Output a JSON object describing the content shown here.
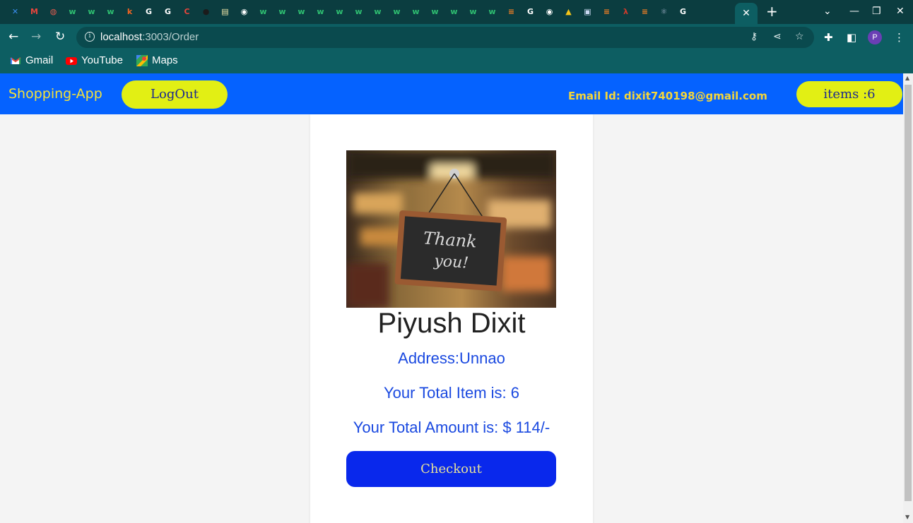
{
  "browser": {
    "tabs": [
      {
        "icon": "confluence-icon",
        "glyph": "✕",
        "color": "#3b8ef0"
      },
      {
        "icon": "gmail-icon",
        "glyph": "M",
        "color": "#e8453c"
      },
      {
        "icon": "globe-icon",
        "glyph": "◍",
        "color": "#e05a4e"
      },
      {
        "icon": "w-icon",
        "glyph": "w",
        "color": "#2fbf71"
      },
      {
        "icon": "w-icon",
        "glyph": "w",
        "color": "#2fbf71"
      },
      {
        "icon": "w-icon",
        "glyph": "w",
        "color": "#2fbf71"
      },
      {
        "icon": "k-icon",
        "glyph": "k",
        "color": "#f26522"
      },
      {
        "icon": "google-icon",
        "glyph": "G",
        "color": "#ffffff"
      },
      {
        "icon": "google-icon",
        "glyph": "G",
        "color": "#ffffff"
      },
      {
        "icon": "c-icon",
        "glyph": "C",
        "color": "#e8453c"
      },
      {
        "icon": "github-icon",
        "glyph": "●",
        "color": "#1b1b1b"
      },
      {
        "icon": "doc-icon",
        "glyph": "▤",
        "color": "#f3e7a8"
      },
      {
        "icon": "chrome-icon",
        "glyph": "◉",
        "color": "#ffffff"
      },
      {
        "icon": "w-icon",
        "glyph": "w",
        "color": "#2fbf71"
      },
      {
        "icon": "w-icon",
        "glyph": "w",
        "color": "#2fbf71"
      },
      {
        "icon": "w-icon",
        "glyph": "w",
        "color": "#2fbf71"
      },
      {
        "icon": "w-icon",
        "glyph": "w",
        "color": "#2fbf71"
      },
      {
        "icon": "w-icon",
        "glyph": "w",
        "color": "#2fbf71"
      },
      {
        "icon": "w-icon",
        "glyph": "w",
        "color": "#2fbf71"
      },
      {
        "icon": "w-icon",
        "glyph": "w",
        "color": "#2fbf71"
      },
      {
        "icon": "w-icon",
        "glyph": "w",
        "color": "#2fbf71"
      },
      {
        "icon": "w-icon",
        "glyph": "w",
        "color": "#2fbf71"
      },
      {
        "icon": "w-icon",
        "glyph": "w",
        "color": "#2fbf71"
      },
      {
        "icon": "w-icon",
        "glyph": "w",
        "color": "#2fbf71"
      },
      {
        "icon": "w-icon",
        "glyph": "w",
        "color": "#2fbf71"
      },
      {
        "icon": "w-icon",
        "glyph": "w",
        "color": "#2fbf71"
      },
      {
        "icon": "stackoverflow-icon",
        "glyph": "≡",
        "color": "#f48024"
      },
      {
        "icon": "google-icon",
        "glyph": "G",
        "color": "#ffffff"
      },
      {
        "icon": "chrome-icon",
        "glyph": "◉",
        "color": "#ffffff"
      },
      {
        "icon": "triangle-icon",
        "glyph": "▲",
        "color": "#f5c518"
      },
      {
        "icon": "app-icon",
        "glyph": "▣",
        "color": "#c9d8f0"
      },
      {
        "icon": "stackoverflow-icon",
        "glyph": "≡",
        "color": "#f48024"
      },
      {
        "icon": "lambda-icon",
        "glyph": "λ",
        "color": "#d23b2b"
      },
      {
        "icon": "stackoverflow-icon",
        "glyph": "≡",
        "color": "#f48024"
      },
      {
        "icon": "react-icon",
        "glyph": "⚛",
        "color": "#9fb0c8"
      },
      {
        "icon": "google-icon",
        "glyph": "G",
        "color": "#ffffff"
      }
    ],
    "active_tab_close": "✕",
    "new_tab": "+",
    "url_host": "localhost",
    "url_path": ":3003/Order",
    "bookmarks": [
      {
        "label": "Gmail",
        "icon": "gmail-icon"
      },
      {
        "label": "YouTube",
        "icon": "youtube-icon"
      },
      {
        "label": "Maps",
        "icon": "maps-icon"
      }
    ],
    "profile_initial": "P"
  },
  "app": {
    "brand": "Shopping-App",
    "logout_label": "LogOut",
    "email": "Email Id: dixit740198@gmail.com",
    "items_label": "items :6"
  },
  "order": {
    "image_caption_line1": "Thank",
    "image_caption_line2": "you!",
    "name": "Piyush Dixit",
    "address": "Address:Unnao",
    "total_items": "Your Total Item is: 6",
    "total_amount": "Your Total Amount is: $ 114/-",
    "checkout_label": "Checkout"
  },
  "colors": {
    "navbar": "#0562ff",
    "pill": "#e2ef14",
    "checkout": "#0928ec",
    "text_blue": "#1a49e0",
    "chrome": "#0d5e62"
  }
}
